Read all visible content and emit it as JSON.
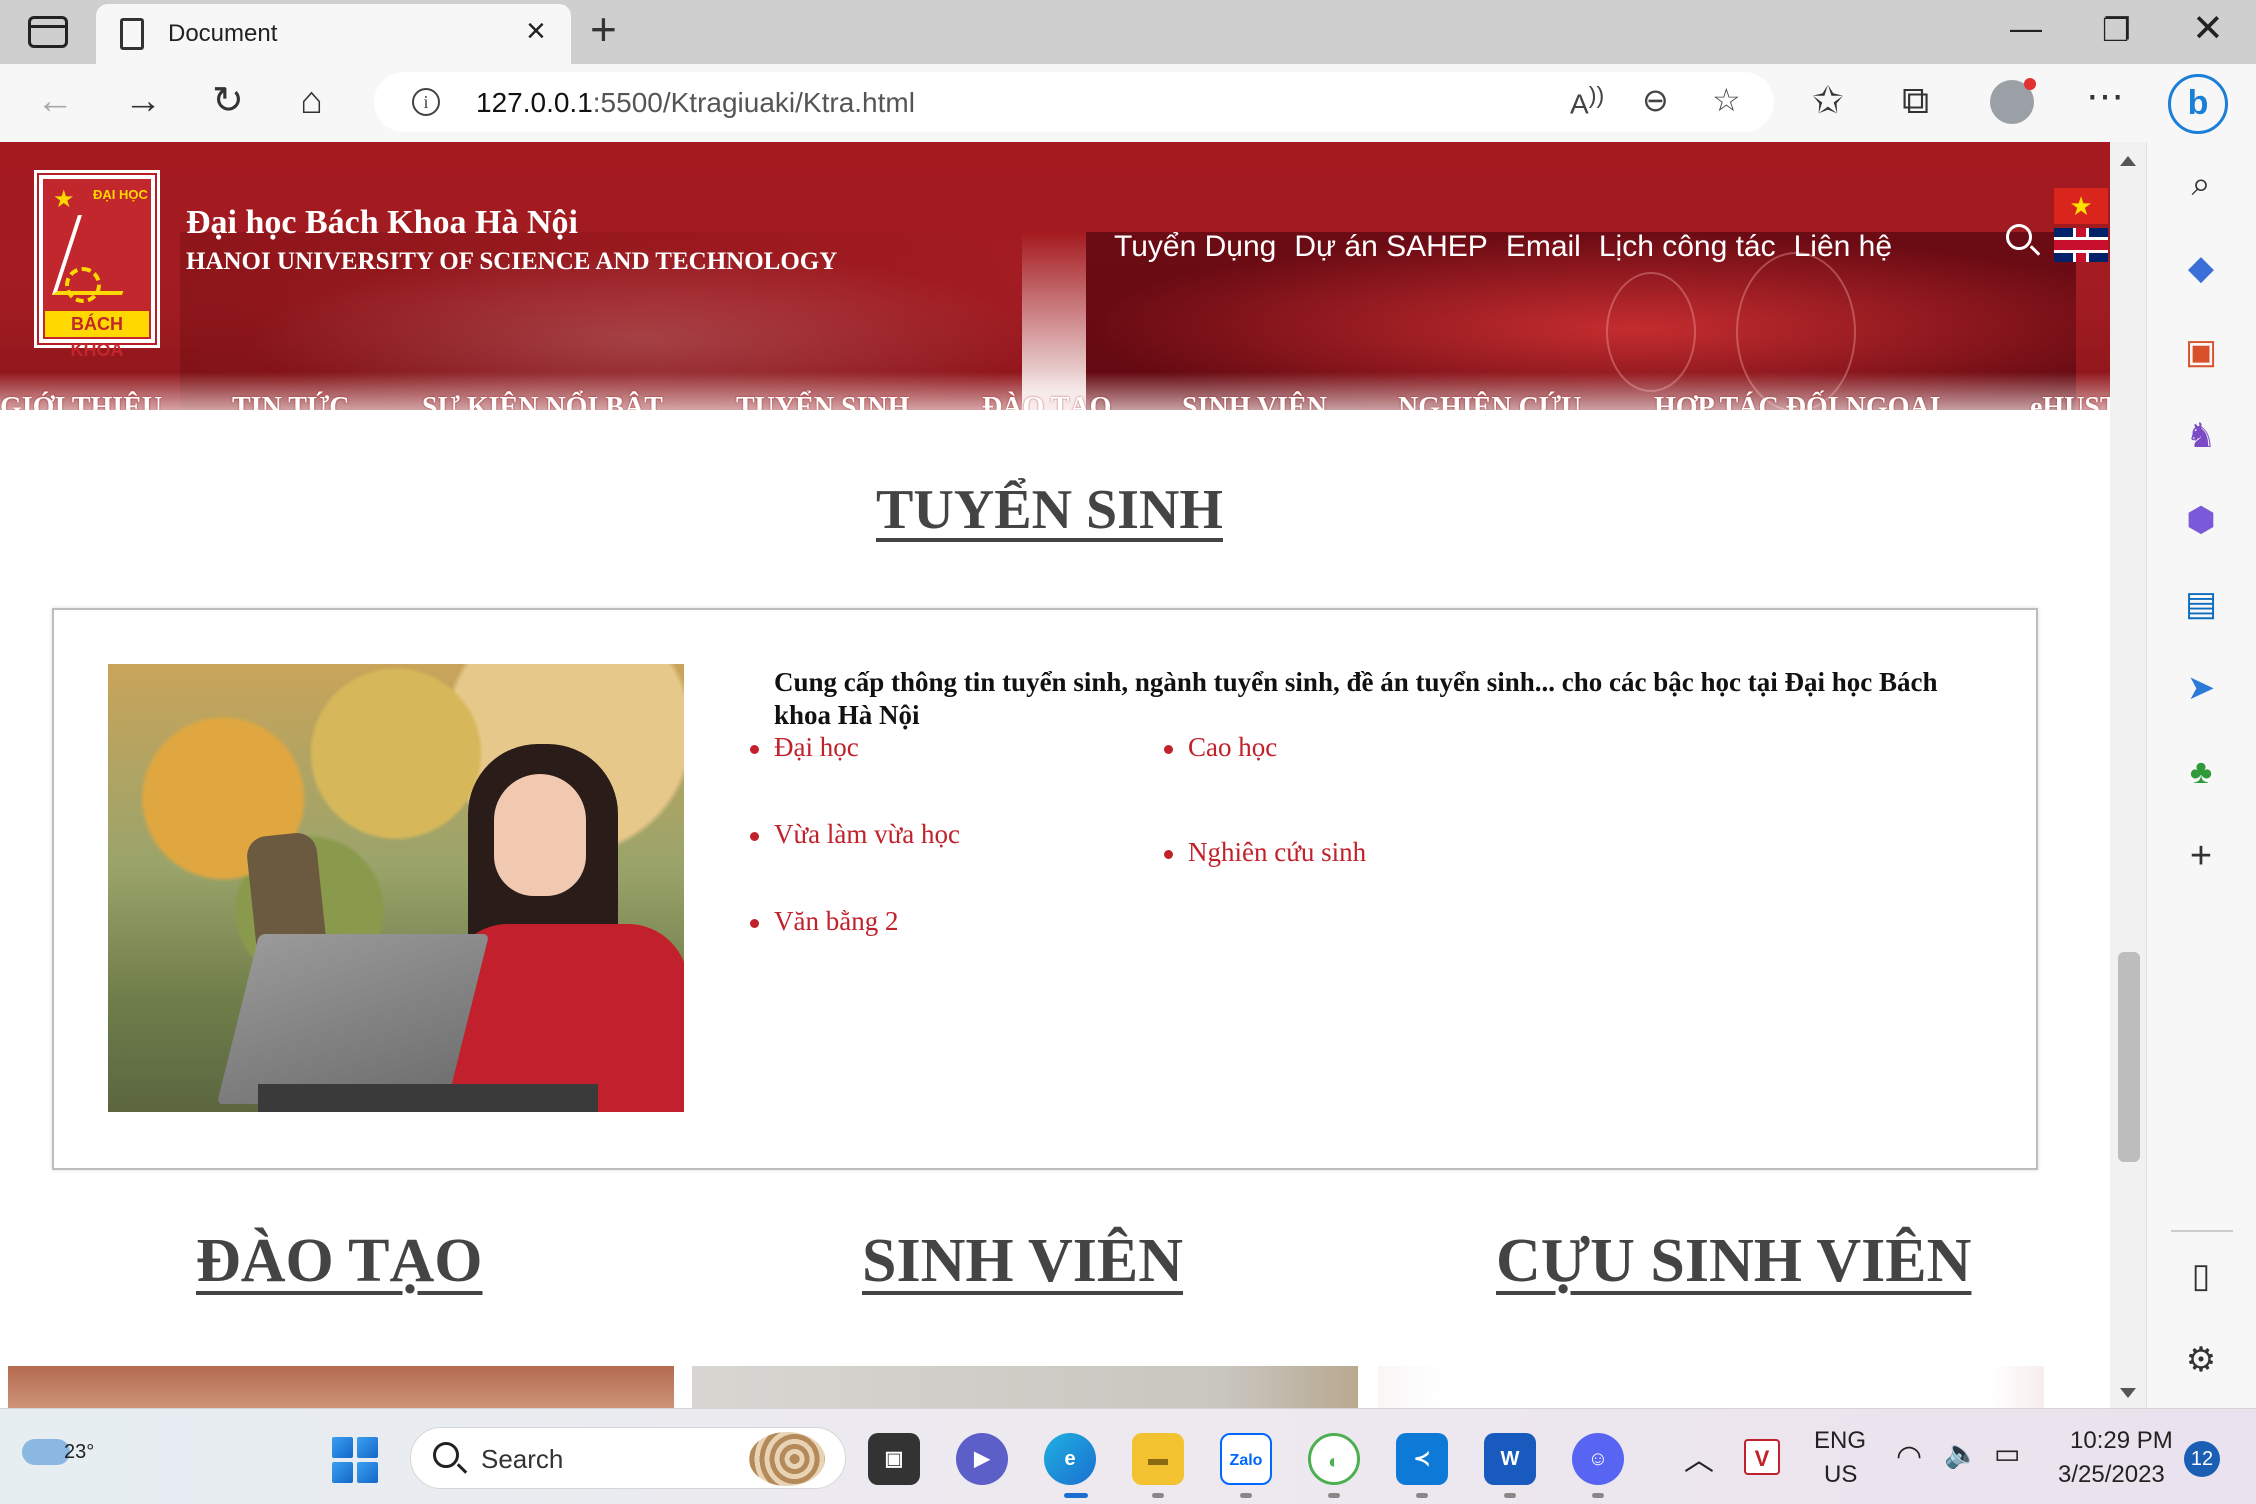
{
  "browser": {
    "tab_title": "Document",
    "url_host": "127.0.0.1",
    "url_rest": ":5500/Ktragiuaki/Ktra.html",
    "icons": [
      "back-icon",
      "forward-icon",
      "refresh-icon",
      "home-icon",
      "read-aloud-icon",
      "zoom-out-icon",
      "add-favorite-icon",
      "favorites-icon",
      "collections-icon",
      "profile-icon",
      "more-icon",
      "bing-icon"
    ]
  },
  "sidebar_icons": [
    "search-icon",
    "shopping-tag-icon",
    "tools-icon",
    "games-icon",
    "office-icon",
    "outlook-icon",
    "send-icon",
    "tree-icon",
    "add-icon",
    "sidebar-layout-icon",
    "settings-icon"
  ],
  "site": {
    "logo_top": "ĐẠI HỌC",
    "logo_bottom": "BÁCH KHOA",
    "name_vn": "Đại học Bách Khoa Hà Nội",
    "name_en": "HANOI UNIVERSITY OF SCIENCE AND TECHNOLOGY",
    "top_links": [
      "Tuyển Dụng",
      "Dự án SAHEP",
      "Email",
      "Lịch công tác",
      "Liên hệ"
    ],
    "main_nav": [
      "GIỚI THIỆU",
      "TIN TỨC",
      "SỰ KIỆN NỔI BẬT",
      "TUYỂN SINH",
      "ĐÀO TẠO",
      "SINH VIÊN",
      "NGHIÊN CỨU",
      "HỢP TÁC ĐỐI NGOẠI",
      "eHUST"
    ]
  },
  "admissions": {
    "title": "TUYỂN SINH",
    "description": "Cung cấp thông tin tuyển sinh, ngành tuyển sinh, đề án tuyển sinh... cho các bậc học tại Đại học Bách khoa Hà Nội",
    "left_links": [
      "Đại học",
      "Vừa làm vừa học",
      "Văn bằng 2"
    ],
    "right_links": [
      "Cao học",
      "Nghiên cứu sinh"
    ]
  },
  "sections": [
    "ĐÀO TẠO",
    "SINH VIÊN",
    "CỰU SINH VIÊN"
  ],
  "taskbar": {
    "temperature": "23°",
    "search_label": "Search",
    "lang_top": "ENG",
    "lang_bottom": "US",
    "time": "10:29 PM",
    "date": "3/25/2023",
    "notifications": "12",
    "zalo_label": "Zalo"
  },
  "colors": {
    "brand_red": "#a41a1f",
    "link_red": "#c0212a",
    "heading_gray": "#444444"
  }
}
